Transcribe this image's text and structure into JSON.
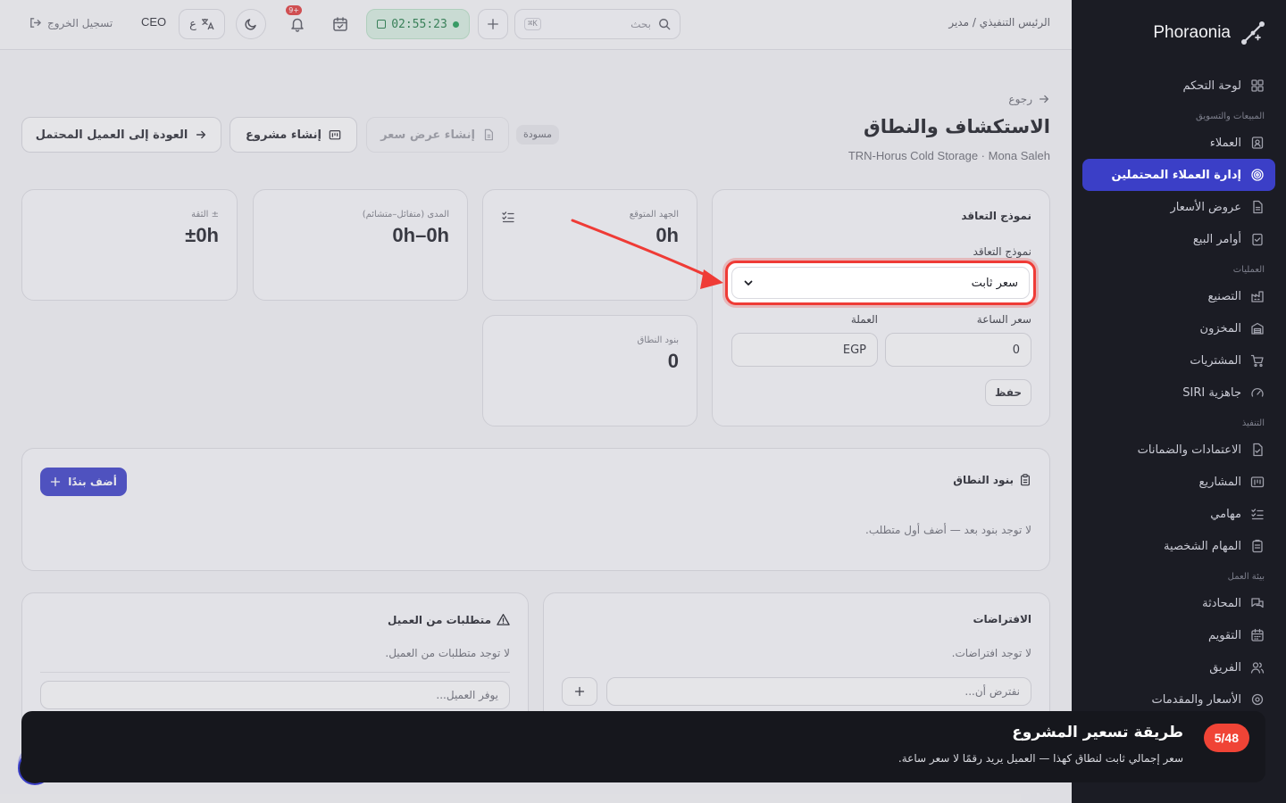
{
  "brand": {
    "name": "Phoraonia"
  },
  "sidebar": {
    "items": [
      {
        "type": "item",
        "label": "لوحة التحكم",
        "icon": "grid-icon"
      },
      {
        "type": "section",
        "label": "المبيعات والتسويق"
      },
      {
        "type": "item",
        "label": "العملاء",
        "icon": "contact-icon"
      },
      {
        "type": "item",
        "label": "إدارة العملاء المحتملين",
        "icon": "target-icon",
        "active": true
      },
      {
        "type": "item",
        "label": "عروض الأسعار",
        "icon": "document-icon"
      },
      {
        "type": "item",
        "label": "أوامر البيع",
        "icon": "clipboard-check-icon"
      },
      {
        "type": "section",
        "label": "العمليات"
      },
      {
        "type": "item",
        "label": "التصنيع",
        "icon": "factory-icon"
      },
      {
        "type": "item",
        "label": "المخزون",
        "icon": "warehouse-icon"
      },
      {
        "type": "item",
        "label": "المشتريات",
        "icon": "cart-icon"
      },
      {
        "type": "item",
        "label": "جاهزية SIRI",
        "icon": "gauge-icon"
      },
      {
        "type": "section",
        "label": "التنفيذ"
      },
      {
        "type": "item",
        "label": "الاعتمادات والضمانات",
        "icon": "file-check-icon"
      },
      {
        "type": "item",
        "label": "المشاريع",
        "icon": "kanban-icon"
      },
      {
        "type": "item",
        "label": "مهامي",
        "icon": "checklist-icon"
      },
      {
        "type": "item",
        "label": "المهام الشخصية",
        "icon": "clipboard-icon"
      },
      {
        "type": "section",
        "label": "بيئة العمل"
      },
      {
        "type": "item",
        "label": "المحادثة",
        "icon": "chat-icon"
      },
      {
        "type": "item",
        "label": "التقويم",
        "icon": "calendar-icon"
      },
      {
        "type": "item",
        "label": "الفريق",
        "icon": "users-icon"
      },
      {
        "type": "item",
        "label": "الأسعار والمقدمات",
        "icon": "tag-icon"
      }
    ]
  },
  "topbar": {
    "user_path": "الرئيس التنفيذي / مدير",
    "search_placeholder": "بحث",
    "search_kbd": "K⌘",
    "timer": "02:55:23",
    "notifications_badge": "+9",
    "lang_label": "ع",
    "role": "CEO",
    "logout": "تسجيل الخروج"
  },
  "page": {
    "back": "رجوع",
    "title": "الاستكشاف والنطاق",
    "subtitle": "TRN-Horus Cold Storage · Mona Saleh",
    "status": "مسودة",
    "actions": {
      "create_quote": "إنشاء عرض سعر",
      "create_project": "إنشاء مشروع",
      "back_to_lead": "العودة إلى العميل المحتمل"
    }
  },
  "contract": {
    "title": "نموذج التعاقد",
    "model_label": "نموذج التعاقد",
    "model_value": "سعر ثابت",
    "hourly_label": "سعر الساعة",
    "hourly_value": "0",
    "currency_label": "العملة",
    "currency_value": "EGP",
    "save": "حفظ"
  },
  "stats": {
    "effort": {
      "label": "الجهد المتوقع",
      "value": "0h"
    },
    "range": {
      "label": "المدى (متفائل–متشائم)",
      "value": "0h–0h"
    },
    "confidence": {
      "label": "± الثقة",
      "value": "±0h"
    },
    "scope_items": {
      "label": "بنود النطاق",
      "value": "0"
    }
  },
  "scope": {
    "title": "بنود النطاق",
    "add": "أضف بندًا",
    "empty": "لا توجد بنود بعد — أضف أول متطلب."
  },
  "assumptions": {
    "title": "الافتراضات",
    "empty": "لا توجد افتراضات.",
    "placeholder": "نفترض أن..."
  },
  "client_reqs": {
    "title": "متطلبات من العميل",
    "empty": "لا توجد متطلبات من العميل.",
    "placeholder": "يوفر العميل..."
  },
  "tour": {
    "step": "5/48",
    "title": "طريقة تسعير المشروع",
    "description": "سعر إجمالي ثابت لنطاق كهذا — العميل يريد رقمًا لا سعر ساعة."
  }
}
